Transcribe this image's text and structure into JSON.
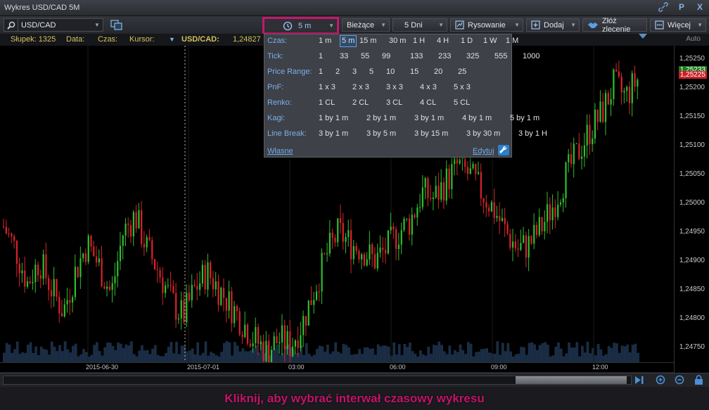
{
  "window": {
    "title": "Wykres USD/CAD 5M",
    "buttons": [
      "P",
      "X"
    ]
  },
  "toolbar": {
    "symbol": "USD/CAD",
    "interval": "5 m",
    "current": "Bieżące",
    "range": "5 Dni",
    "drawing": "Rysowanie",
    "add": "Dodaj",
    "order": "Złóż zlecenie",
    "more": "Więcej"
  },
  "infobar": {
    "bar_label": "Słupek: 1325",
    "date_label": "Data:",
    "time_label": "Czas:",
    "cursor_label": "Kursor:",
    "pair_label": "USD/CAD:",
    "pair_value": "1,24827",
    "auto": "Auto"
  },
  "dropdown": {
    "rows": [
      {
        "label": "Czas:",
        "options": [
          "1 m",
          "5 m",
          "15 m",
          "30 m",
          "1 H",
          "4 H",
          "1 D",
          "1 W",
          "1 M"
        ],
        "selected": "5 m"
      },
      {
        "label": "Tick:",
        "options": [
          "1",
          "33",
          "55",
          "99",
          "133",
          "233",
          "325",
          "555",
          "1000"
        ]
      },
      {
        "label": "Price Range:",
        "options": [
          "1",
          "2",
          "3",
          "5",
          "10",
          "15",
          "20",
          "25"
        ]
      },
      {
        "label": "PnF:",
        "options": [
          "1 x 3",
          "2 x 3",
          "3 x 3",
          "4 x 3",
          "5 x 3"
        ]
      },
      {
        "label": "Renko:",
        "options": [
          "1 CL",
          "2 CL",
          "3 CL",
          "4 CL",
          "5 CL"
        ]
      },
      {
        "label": "Kagi:",
        "options": [
          "1 by 1 m",
          "2 by 1 m",
          "3 by 1 m",
          "4 by 1 m",
          "5 by 1 m"
        ]
      },
      {
        "label": "Line Break:",
        "options": [
          "3 by 1 m",
          "3 by 5 m",
          "3 by 15 m",
          "3 by 30 m",
          "3 by 1 H"
        ]
      }
    ],
    "custom_link": "Własne",
    "edit_link": "Edytuj"
  },
  "chart_data": {
    "type": "candlestick",
    "y_ticks": [
      "1,25250",
      "1,25200",
      "1,25150",
      "1,25100",
      "1,25050",
      "1,25000",
      "1,24950",
      "1,24900",
      "1,24850",
      "1,24800",
      "1,24750"
    ],
    "y_range": [
      1.2473,
      1.2529
    ],
    "x_ticks": [
      "2015-06-30",
      "2015-07-01",
      "03:00",
      "06:00",
      "09:00",
      "12:00"
    ],
    "current_price": "1,25225",
    "marker_price": "1,25233",
    "colors": {
      "up": "#2fbf2f",
      "down": "#d8232a",
      "volume": "#1f3550"
    },
    "closes": [
      1.2497,
      1.2493,
      1.2487,
      1.2491,
      1.2486,
      1.2482,
      1.2489,
      1.2494,
      1.249,
      1.2485,
      1.2496,
      1.2499,
      1.2493,
      1.2489,
      1.2484,
      1.2481,
      1.2486,
      1.2489,
      1.2486,
      1.2483,
      1.248,
      1.2477,
      1.2475,
      1.2477,
      1.2476,
      1.248,
      1.2486,
      1.2492,
      1.2496,
      1.2494,
      1.2493,
      1.2491,
      1.2493,
      1.2496,
      1.2498,
      1.2503,
      1.2502,
      1.2505,
      1.2508,
      1.2506,
      1.2503,
      1.25,
      1.2496,
      1.2493,
      1.2494,
      1.2497,
      1.2501,
      1.2506,
      1.251,
      1.2514,
      1.2517,
      1.2522,
      1.252,
      1.2523
    ]
  },
  "hint": "Kliknij, aby wybrać interwał czasowy wykresu"
}
